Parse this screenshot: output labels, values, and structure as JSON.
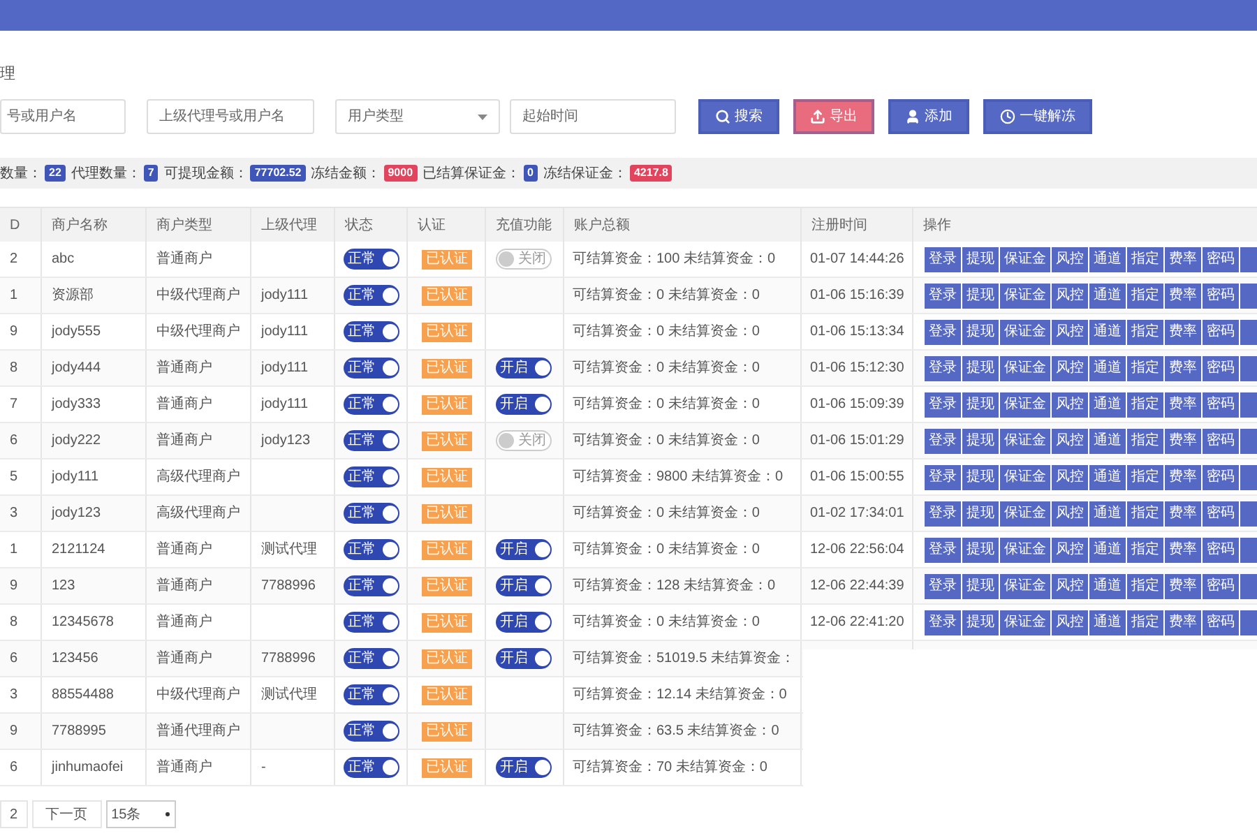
{
  "page_title": "理",
  "filters": {
    "account": {
      "placeholder": "号或用户名"
    },
    "parent": {
      "placeholder": "上级代理号或用户名"
    },
    "user_type": {
      "placeholder": "用户类型"
    },
    "start_time": {
      "placeholder": "起始时间"
    }
  },
  "buttons": [
    {
      "label": "搜索",
      "color": "#5468c4"
    },
    {
      "label": "导出",
      "color": "#e86b7e"
    },
    {
      "label": "添加",
      "color": "#5468c4"
    },
    {
      "label": "一键解冻",
      "color": "#5468c4"
    }
  ],
  "stats": [
    {
      "label": "数量：",
      "value": "22",
      "color": "#3f55b8"
    },
    {
      "label": "代理数量：",
      "value": "7",
      "color": "#3f55b8"
    },
    {
      "label": "可提现金额：",
      "value": "77702.52",
      "color": "#3f55b8"
    },
    {
      "label": "冻结金额：",
      "value": "9000",
      "color": "#e2435d"
    },
    {
      "label": "已结算保证金：",
      "value": "0",
      "color": "#3f55b8"
    },
    {
      "label": "冻结保证金：",
      "value": "4217.8",
      "color": "#e2435d"
    }
  ],
  "table": {
    "columns": [
      "D",
      "商户名称",
      "商户类型",
      "上级代理",
      "状态",
      "认证",
      "充值功能",
      "账户总额",
      "注册时间",
      "操作"
    ],
    "rows": [
      {
        "id": "2",
        "name": "abc",
        "type": "普通商户",
        "parent": "",
        "status": {
          "label": "正常",
          "on": true
        },
        "auth": "已认证",
        "recharge": {
          "label": "关闭",
          "on": false
        },
        "account": "可结算资金：100 未结算资金：0",
        "time": "01-07 14:44:26",
        "actions": [
          "登录",
          "提现",
          "保证金",
          "风控",
          "通道",
          "指定",
          "费率",
          "密码"
        ]
      },
      {
        "id": "1",
        "name": "资源部",
        "type": "中级代理商户",
        "parent": "jody111",
        "status": {
          "label": "正常",
          "on": true
        },
        "auth": "已认证",
        "account": "可结算资金：0 未结算资金：0",
        "time": "01-06 15:16:39",
        "actions": [
          "登录",
          "提现",
          "保证金",
          "风控",
          "通道",
          "指定",
          "费率",
          "密码"
        ]
      },
      {
        "id": "9",
        "name": "jody555",
        "type": "中级代理商户",
        "parent": "jody111",
        "status": {
          "label": "正常",
          "on": true
        },
        "auth": "已认证",
        "account": "可结算资金：0 未结算资金：0",
        "time": "01-06 15:13:34",
        "actions": [
          "登录",
          "提现",
          "保证金",
          "风控",
          "通道",
          "指定",
          "费率",
          "密码"
        ]
      },
      {
        "id": "8",
        "name": "jody444",
        "type": "普通商户",
        "parent": "jody111",
        "status": {
          "label": "正常",
          "on": true
        },
        "auth": "已认证",
        "recharge": {
          "label": "开启",
          "on": true
        },
        "account": "可结算资金：0 未结算资金：0",
        "time": "01-06 15:12:30",
        "actions": [
          "登录",
          "提现",
          "保证金",
          "风控",
          "通道",
          "指定",
          "费率",
          "密码"
        ]
      },
      {
        "id": "7",
        "name": "jody333",
        "type": "普通商户",
        "parent": "jody111",
        "status": {
          "label": "正常",
          "on": true
        },
        "auth": "已认证",
        "recharge": {
          "label": "开启",
          "on": true
        },
        "account": "可结算资金：0 未结算资金：0",
        "time": "01-06 15:09:39",
        "actions": [
          "登录",
          "提现",
          "保证金",
          "风控",
          "通道",
          "指定",
          "费率",
          "密码"
        ]
      },
      {
        "id": "6",
        "name": "jody222",
        "type": "普通商户",
        "parent": "jody123",
        "status": {
          "label": "正常",
          "on": true
        },
        "auth": "已认证",
        "recharge": {
          "label": "关闭",
          "on": false
        },
        "account": "可结算资金：0 未结算资金：0",
        "time": "01-06 15:01:29",
        "actions": [
          "登录",
          "提现",
          "保证金",
          "风控",
          "通道",
          "指定",
          "费率",
          "密码"
        ]
      },
      {
        "id": "5",
        "name": "jody111",
        "type": "高级代理商户",
        "parent": "",
        "status": {
          "label": "正常",
          "on": true
        },
        "auth": "已认证",
        "account": "可结算资金：9800 未结算资金：0",
        "time": "01-06 15:00:55",
        "actions": [
          "登录",
          "提现",
          "保证金",
          "风控",
          "通道",
          "指定",
          "费率",
          "密码"
        ]
      },
      {
        "id": "3",
        "name": "jody123",
        "type": "高级代理商户",
        "parent": "",
        "status": {
          "label": "正常",
          "on": true
        },
        "auth": "已认证",
        "account": "可结算资金：0 未结算资金：0",
        "time": "01-02 17:34:01",
        "actions": [
          "登录",
          "提现",
          "保证金",
          "风控",
          "通道",
          "指定",
          "费率",
          "密码"
        ]
      },
      {
        "id": "1",
        "name": "2121124",
        "type": "普通商户",
        "parent": "测试代理",
        "status": {
          "label": "正常",
          "on": true
        },
        "auth": "已认证",
        "recharge": {
          "label": "开启",
          "on": true
        },
        "account": "可结算资金：0 未结算资金：0",
        "time": "12-06 22:56:04",
        "actions": [
          "登录",
          "提现",
          "保证金",
          "风控",
          "通道",
          "指定",
          "费率",
          "密码"
        ]
      },
      {
        "id": "9",
        "name": "123",
        "type": "普通商户",
        "parent": "7788996",
        "status": {
          "label": "正常",
          "on": true
        },
        "auth": "已认证",
        "recharge": {
          "label": "开启",
          "on": true
        },
        "account": "可结算资金：128 未结算资金：0",
        "time": "12-06 22:44:39",
        "actions": [
          "登录",
          "提现",
          "保证金",
          "风控",
          "通道",
          "指定",
          "费率",
          "密码"
        ]
      },
      {
        "id": "8",
        "name": "12345678",
        "type": "普通商户",
        "parent": "",
        "status": {
          "label": "正常",
          "on": true
        },
        "auth": "已认证",
        "recharge": {
          "label": "开启",
          "on": true
        },
        "account": "可结算资金：0 未结算资金：0",
        "time": "12-06 22:41:20",
        "actions": [
          "登录",
          "提现",
          "保证金",
          "风控",
          "通道",
          "指定",
          "费率",
          "密码"
        ]
      },
      {
        "id": "6",
        "name": "123456",
        "type": "普通商户",
        "parent": "7788996",
        "status": {
          "label": "正常",
          "on": true
        },
        "auth": "已认证",
        "recharge": {
          "label": "开启",
          "on": true
        },
        "account": "可结算资金：51019.5 未结算资金："
      },
      {
        "id": "3",
        "name": "88554488",
        "type": "中级代理商户",
        "parent": "测试代理",
        "status": {
          "label": "正常",
          "on": true
        },
        "auth": "已认证",
        "account": "可结算资金：12.14 未结算资金：0"
      },
      {
        "id": "9",
        "name": "7788995",
        "type": "普通代理商户",
        "parent": "",
        "status": {
          "label": "正常",
          "on": true
        },
        "auth": "已认证",
        "account": "可结算资金：63.5 未结算资金：0"
      },
      {
        "id": "6",
        "name": "jinhumaofei",
        "type": "普通商户",
        "parent": "-",
        "status": {
          "label": "正常",
          "on": true
        },
        "auth": "已认证",
        "recharge": {
          "label": "开启",
          "on": true
        },
        "account": "可结算资金：70 未结算资金：0"
      }
    ]
  },
  "pagination": {
    "page": "2",
    "next": "下一页",
    "page_size": "15条"
  }
}
